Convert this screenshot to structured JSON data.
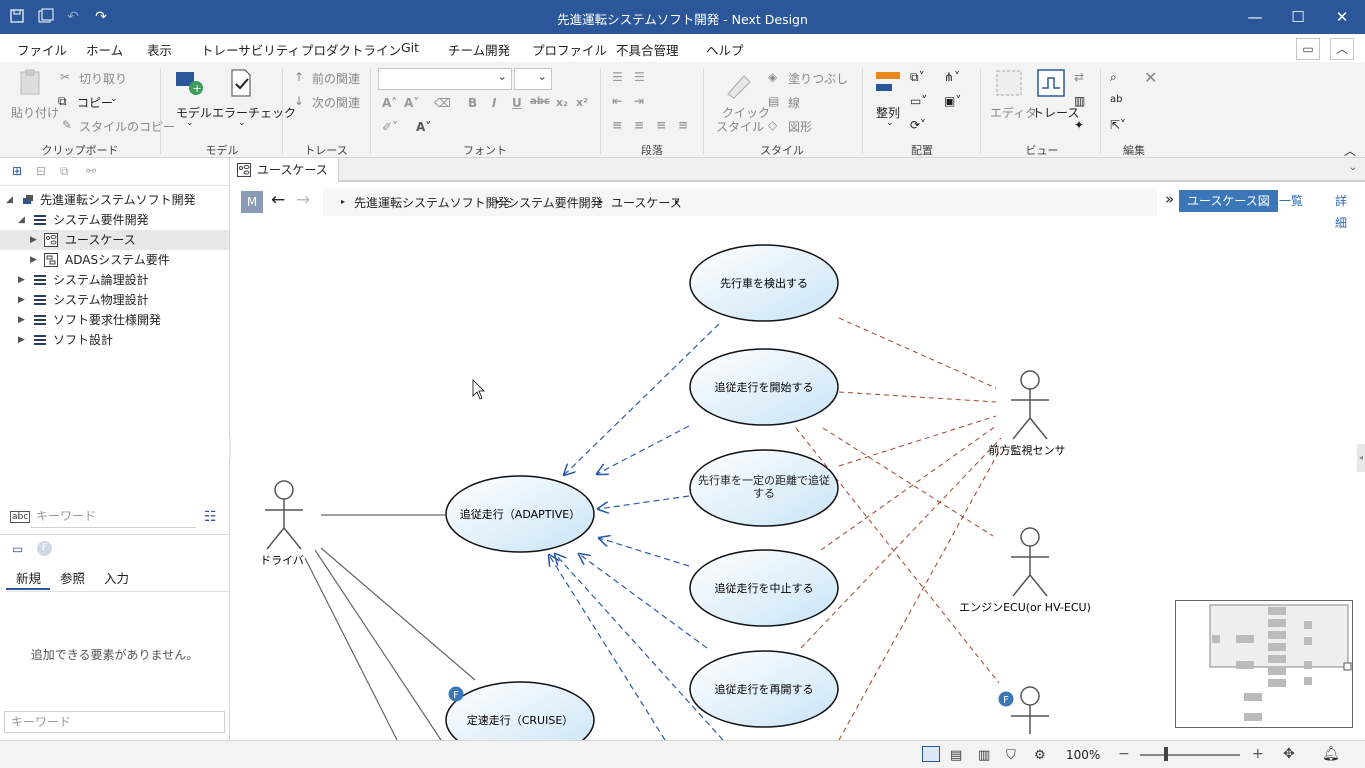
{
  "window": {
    "title": "先進運転システムソフト開発 - Next Design"
  },
  "menu": {
    "items": [
      "ファイル",
      "ホーム",
      "表示",
      "トレーサビリティ",
      "プロダクトライン",
      "Git",
      "チーム開発",
      "プロファイル",
      "不具合管理",
      "ヘルプ"
    ],
    "active": "ホーム"
  },
  "ribbon": {
    "clipboard": {
      "paste": "貼り付け",
      "cut": "切り取り",
      "copy": "コピー",
      "copy_style": "スタイルのコピー",
      "label": "クリップボード"
    },
    "model": {
      "model": "モデル",
      "error_check": "エラーチェック",
      "label": "モデル"
    },
    "trace": {
      "prev": "前の関連",
      "next": "次の関連",
      "label": "トレース"
    },
    "font": {
      "label": "フォント"
    },
    "paragraph": {
      "label": "段落"
    },
    "style": {
      "quick_style": "クイック",
      "quick_style2": "スタイル",
      "fill": "塗りつぶし",
      "line": "線",
      "shape": "図形",
      "label": "スタイル"
    },
    "layout": {
      "align": "整列",
      "label": "配置"
    },
    "view": {
      "editor": "エディタ",
      "trace": "トレース",
      "label": "ビュー"
    },
    "edit": {
      "label": "編集"
    }
  },
  "tree": {
    "root": "先進運転システムソフト開発",
    "items": [
      {
        "label": "システム要件開発",
        "level": 1,
        "expanded": true
      },
      {
        "label": "ユースケース",
        "level": 2,
        "selected": true
      },
      {
        "label": "ADASシステム要件",
        "level": 2
      },
      {
        "label": "システム論理設計",
        "level": 1
      },
      {
        "label": "システム物理設計",
        "level": 1
      },
      {
        "label": "ソフト要求仕様開発",
        "level": 1
      },
      {
        "label": "ソフト設計",
        "level": 1
      }
    ],
    "search_placeholder": "キーワード"
  },
  "palette": {
    "tabs": [
      "新規",
      "参照",
      "入力"
    ],
    "active_tab": "新規",
    "empty_message": "追加できる要素がありません。",
    "search_placeholder": "キーワード"
  },
  "editor": {
    "tab_label": "ユースケース",
    "m_badge": "M",
    "breadcrumb": [
      "先進運転システムソフト開発",
      "システム要件開発",
      "ユースケース"
    ],
    "more": "»",
    "views": [
      "ユースケース図",
      "一覧",
      "詳細"
    ],
    "active_view": "ユースケース図"
  },
  "diagram": {
    "usecases": [
      {
        "id": "uc1",
        "label": "先行車を検出する"
      },
      {
        "id": "uc2",
        "label": "追従走行を開始する"
      },
      {
        "id": "uc3",
        "label": "先行車を一定の距離で追従する"
      },
      {
        "id": "uc4",
        "label": "追従走行を中止する"
      },
      {
        "id": "uc5",
        "label": "追従走行を再開する"
      },
      {
        "id": "uc6",
        "label": "追従走行（ADAPTIVE）"
      },
      {
        "id": "uc7",
        "label": "定速走行（CRUISE）"
      }
    ],
    "actors": [
      {
        "id": "a1",
        "label": "ドライバ"
      },
      {
        "id": "a2",
        "label": "前方監視センサ"
      },
      {
        "id": "a3",
        "label": "エンジンECU(or HV-ECU)"
      },
      {
        "id": "a4",
        "label": ""
      }
    ],
    "feature_badge": "F",
    "colors": {
      "include": "#2b5aa8",
      "actor_link": "#a0442a",
      "assoc": "#666666"
    }
  },
  "status": {
    "zoom": "100%"
  }
}
